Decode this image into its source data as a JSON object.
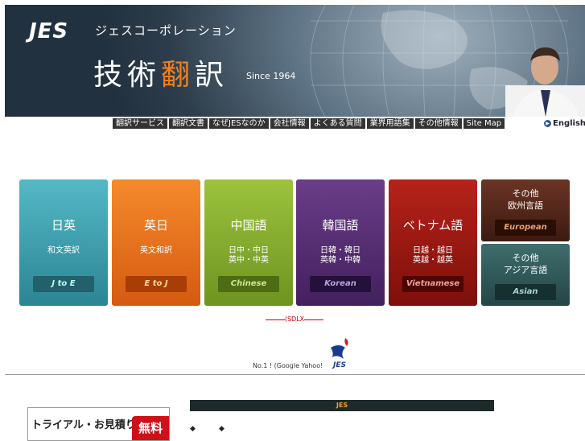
{
  "header": {
    "logo": "JES",
    "company_kana": "ジェスコーポレーション",
    "title_a": "技術",
    "title_b": "翻",
    "title_c": "訳",
    "since": "Since 1964"
  },
  "nav": {
    "items": [
      "翻訳サービス",
      "翻訳文書",
      "なぜJESなのか",
      "会社情報",
      "よくある質問",
      "業界用語集",
      "その他情報",
      "Site Map"
    ],
    "english": "English"
  },
  "tiles": {
    "en": {
      "name": "日英",
      "sub": "和文英訳",
      "label": "J to E"
    },
    "je": {
      "name": "英日",
      "sub": "英文和訳",
      "label": "E to J"
    },
    "zh": {
      "name": "中国語",
      "sub1": "日中・中日",
      "sub2": "英中・中英",
      "label": "Chinese"
    },
    "ko": {
      "name": "韓国語",
      "sub1": "日韓・韓日",
      "sub2": "英韓・中韓",
      "label": "Korean"
    },
    "vi": {
      "name": "ベトナム語",
      "sub1": "日越・越日",
      "sub2": "英越・越英",
      "label": "Vietnamese"
    },
    "eu": {
      "name1": "その他",
      "name2": "欧州言語",
      "label": "European"
    },
    "as": {
      "name1": "その他",
      "name2": "アジア言語",
      "label": "Asian"
    }
  },
  "misc": {
    "sdlx": "(SDLX",
    "no1": "No.1 ! (Google Yahoo!",
    "trial": "トライアル・お見積り",
    "trial_badge": "無料",
    "news_bar": "JES",
    "bullet": "◆"
  },
  "colors": {
    "accent_orange": "#f08020",
    "nav_bg": "#333333"
  }
}
